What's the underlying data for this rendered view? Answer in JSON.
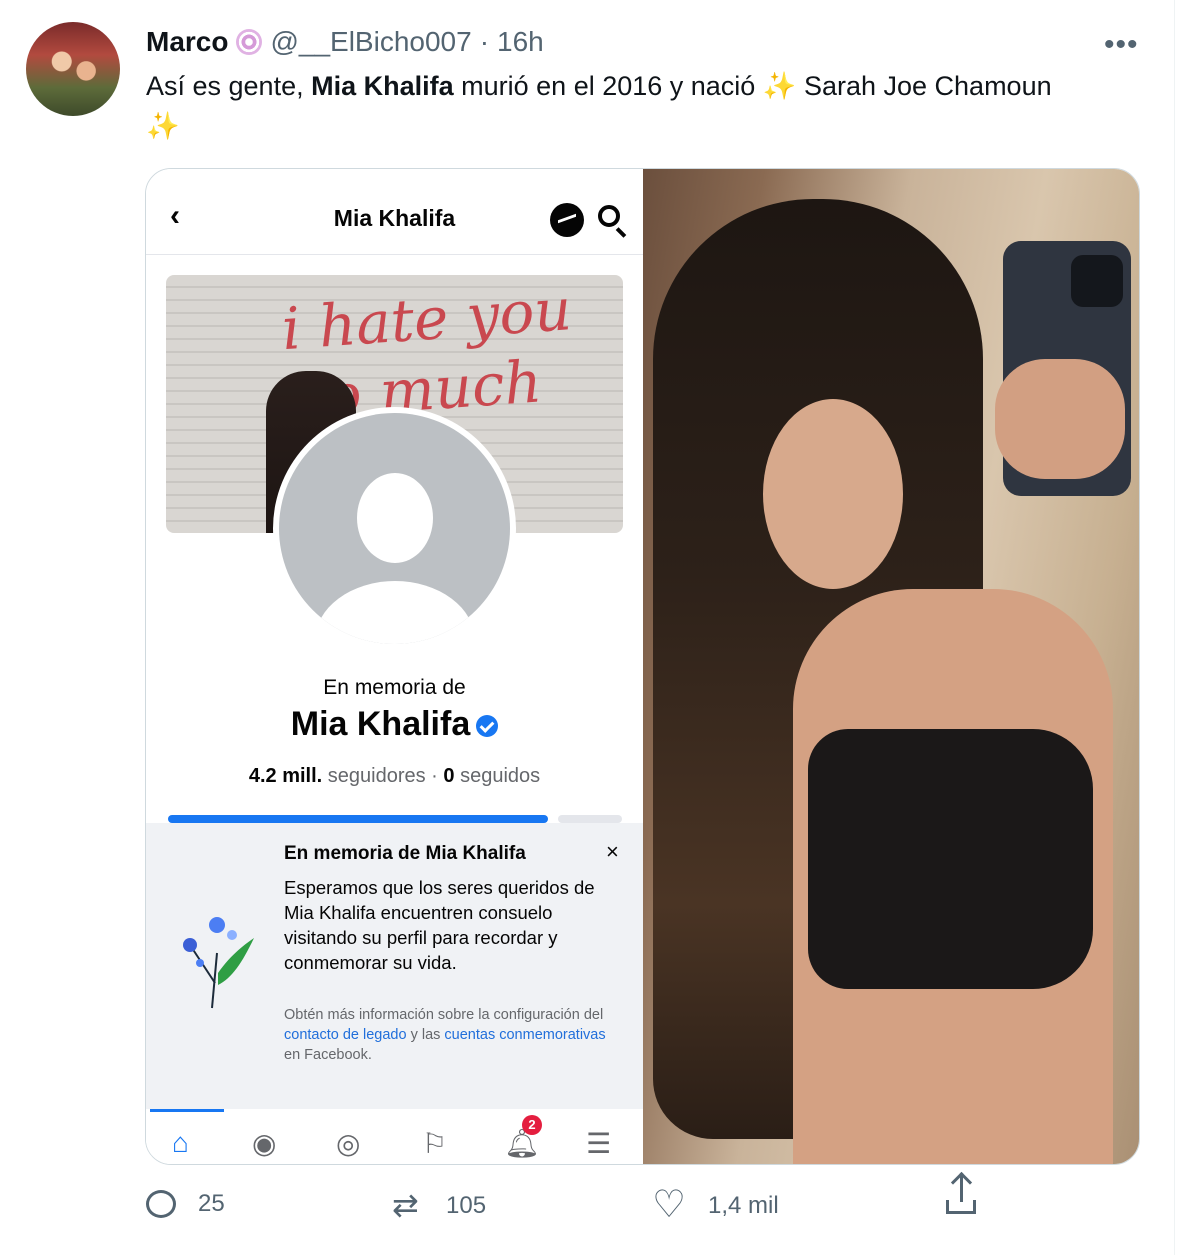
{
  "tweet": {
    "display_name": "Marco",
    "handle": "@__ElBicho007",
    "separator": "·",
    "time": "16h",
    "text_part1": "Así es gente, ",
    "text_bold": "Mia Khalifa",
    "text_part2": " murió en el 2016 y nació ",
    "sparkle": "✨",
    "text_part3": " Sarah Joe Chamoun",
    "more_icon": "more-horizontal-icon"
  },
  "fb_screenshot": {
    "header_title": "Mia Khalifa",
    "cover_text": "i hate you So much",
    "memorial_label": "En memoria de",
    "profile_name": "Mia Khalifa",
    "followers_count": "4.2 mill.",
    "followers_label": "seguidores",
    "stats_sep": "·",
    "following_count": "0",
    "following_label": "seguidos",
    "notice": {
      "title": "En memoria de Mia Khalifa",
      "close": "×",
      "body": "Esperamos que los seres queridos de Mia Khalifa encuentren consuelo visitando su perfil para recordar y conmemorar su vida.",
      "small_1": "Obtén más información sobre la configuración del ",
      "link_1": "contacto de legado",
      "small_2": " y las ",
      "link_2": "cuentas conmemorativas",
      "small_3": " en Facebook."
    },
    "tabs": [
      "home-icon",
      "profile-icon",
      "groups-icon",
      "pages-flag-icon",
      "notifications-bell-icon",
      "menu-icon"
    ],
    "notification_badge": "2"
  },
  "actions": {
    "replies": "25",
    "retweets": "105",
    "likes": "1,4 mil"
  },
  "colors": {
    "twitter_grey": "#536471",
    "fb_blue": "#1877f2",
    "notice_bg": "#f0f2f5"
  }
}
